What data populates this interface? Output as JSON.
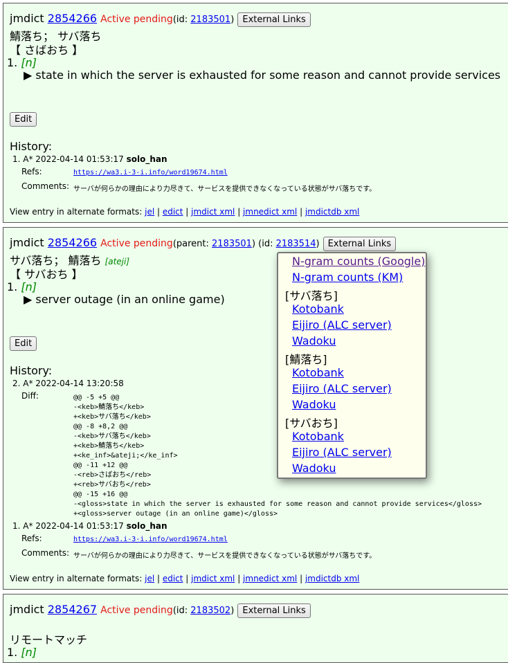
{
  "entries": [
    {
      "corpus": "jmdict",
      "seq": "2854266",
      "status": "Active pending",
      "id_prefix": "(id: ",
      "id": "2183501",
      "id_suffix": ")",
      "ext_btn": "External Links",
      "kanji": "鯖落ち； サバ落ち",
      "reading": "【 さばおち 】",
      "sense_num": "1.",
      "pos": "[n]",
      "gloss": "▶ state in which the server is exhausted for some reason and cannot provide services",
      "edit_btn": "Edit",
      "history_title": "History:",
      "history": [
        {
          "num": "1.",
          "stamp": "A* 2022-04-14 01:53:17",
          "user": "solo_han",
          "refs_label": "Refs:",
          "refs_url": "https://wa3.i-3-i.info/word19674.html",
          "comments_label": "Comments:",
          "comments": "サーバが何らかの理由により力尽きて、サービスを提供できなくなっている状態がサバ落ちです。"
        }
      ],
      "formats_label": "View entry in alternate formats:",
      "formats": [
        "jel",
        "edict",
        "jmdict xml",
        "jmnedict xml",
        "jmdictdb xml"
      ]
    },
    {
      "corpus": "jmdict",
      "seq": "2854266",
      "status": "Active pending",
      "parent_prefix": "(parent: ",
      "parent": "2183501",
      "id_prefix": ") (id: ",
      "id": "2183514",
      "id_suffix": ")",
      "ext_btn": "External Links",
      "kanji": "サバ落ち； 鯖落ち",
      "ateji": "[ateji]",
      "reading": "【 サバおち 】",
      "sense_num": "1.",
      "pos": "[n]",
      "gloss": "▶ server outage (in an online game)",
      "edit_btn": "Edit",
      "history_title": "History:",
      "history2": {
        "num": "2.",
        "stamp": "A* 2022-04-14 13:20:58",
        "diff_label": "Diff:",
        "diff": [
          "@@ -5 +5 @@",
          "-<keb>鯖落ち</keb>",
          "+<keb>サバ落ち</keb>",
          "@@ -8 +8,2 @@",
          "-<keb>サバ落ち</keb>",
          "+<keb>鯖落ち</keb>",
          "+<ke_inf>&ateji;</ke_inf>",
          "@@ -11 +12 @@",
          "-<reb>さばおち</reb>",
          "+<reb>サバおち</reb>",
          "@@ -15 +16 @@",
          "-<gloss>state in which the server is exhausted for some reason and cannot provide services</gloss>",
          "+<gloss>server outage (in an online game)</gloss>"
        ]
      },
      "history1": {
        "num": "1.",
        "stamp": "A* 2022-04-14 01:53:17",
        "user": "solo_han",
        "refs_label": "Refs:",
        "refs_url": "https://wa3.i-3-i.info/word19674.html",
        "comments_label": "Comments:",
        "comments": "サーバが何らかの理由により力尽きて、サービスを提供できなくなっている状態がサバ落ちです。"
      },
      "formats_label": "View entry in alternate formats:",
      "formats": [
        "jel",
        "edict",
        "jmdict xml",
        "jmnedict xml",
        "jmdictdb xml"
      ]
    },
    {
      "corpus": "jmdict",
      "seq": "2854267",
      "status": "Active pending",
      "id_prefix": "(id: ",
      "id": "2183502",
      "id_suffix": ")",
      "ext_btn": "External Links",
      "kana": "リモートマッチ",
      "sense_num": "1.",
      "pos": "[n]"
    }
  ],
  "popup": {
    "links_top": [
      "N-gram counts (Google)",
      "N-gram counts (KM)"
    ],
    "groups": [
      {
        "heading": "[サバ落ち]",
        "links": [
          "Kotobank",
          "Eijiro (ALC server)",
          "Wadoku"
        ]
      },
      {
        "heading": "[鯖落ち]",
        "links": [
          "Kotobank",
          "Eijiro (ALC server)",
          "Wadoku"
        ]
      },
      {
        "heading": "[サバおち]",
        "links": [
          "Kotobank",
          "Eijiro (ALC server)",
          "Wadoku"
        ]
      }
    ]
  },
  "colors": {
    "entry_bg": "#eeffee",
    "status_red": "#e41b17",
    "pos_green": "#008800",
    "popup_bg": "#ffffee",
    "link": "#0000ee",
    "visited_link": "#551a8b"
  }
}
